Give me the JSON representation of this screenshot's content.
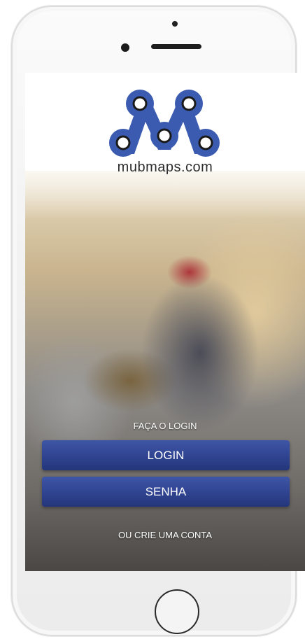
{
  "brand": {
    "site": "mubmaps.com",
    "logo_text": "mubmaps.com"
  },
  "login": {
    "prompt": "FAÇA O LOGIN",
    "login_label": "LOGIN",
    "password_label": "SENHA",
    "create_account": "OU CRIE UMA CONTA"
  },
  "colors": {
    "accent": "#2f4390",
    "logo": "#3b5bb0"
  }
}
